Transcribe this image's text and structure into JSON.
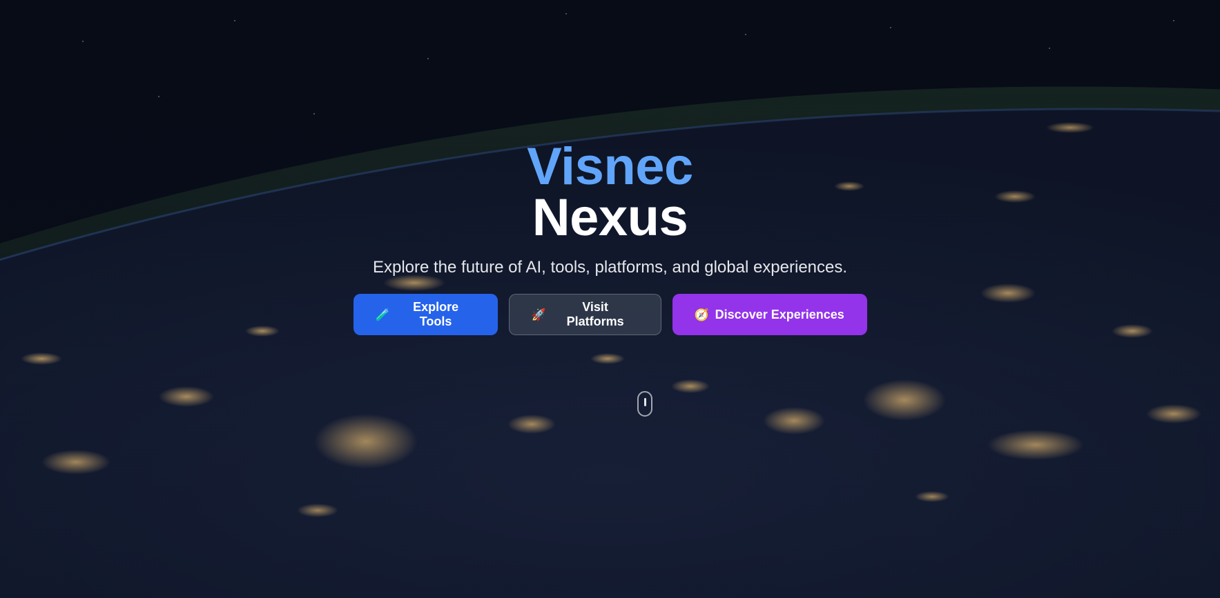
{
  "hero": {
    "title_line1": "Visnec",
    "title_line2": "Nexus",
    "tagline": "Explore the future of AI, tools, platforms, and global experiences."
  },
  "buttons": [
    {
      "label": "Explore Tools",
      "icon": "test-tube-icon",
      "glyph": "🧪",
      "color": "#2563eb"
    },
    {
      "label": "Visit Platforms",
      "icon": "rocket-icon",
      "glyph": "🚀",
      "color": "#374151"
    },
    {
      "label": "Discover Experiences",
      "icon": "compass-icon",
      "glyph": "🧭",
      "color": "#9333ea"
    }
  ],
  "colors": {
    "accent_blue": "#60a5fa",
    "background": "#0a0f1c"
  }
}
